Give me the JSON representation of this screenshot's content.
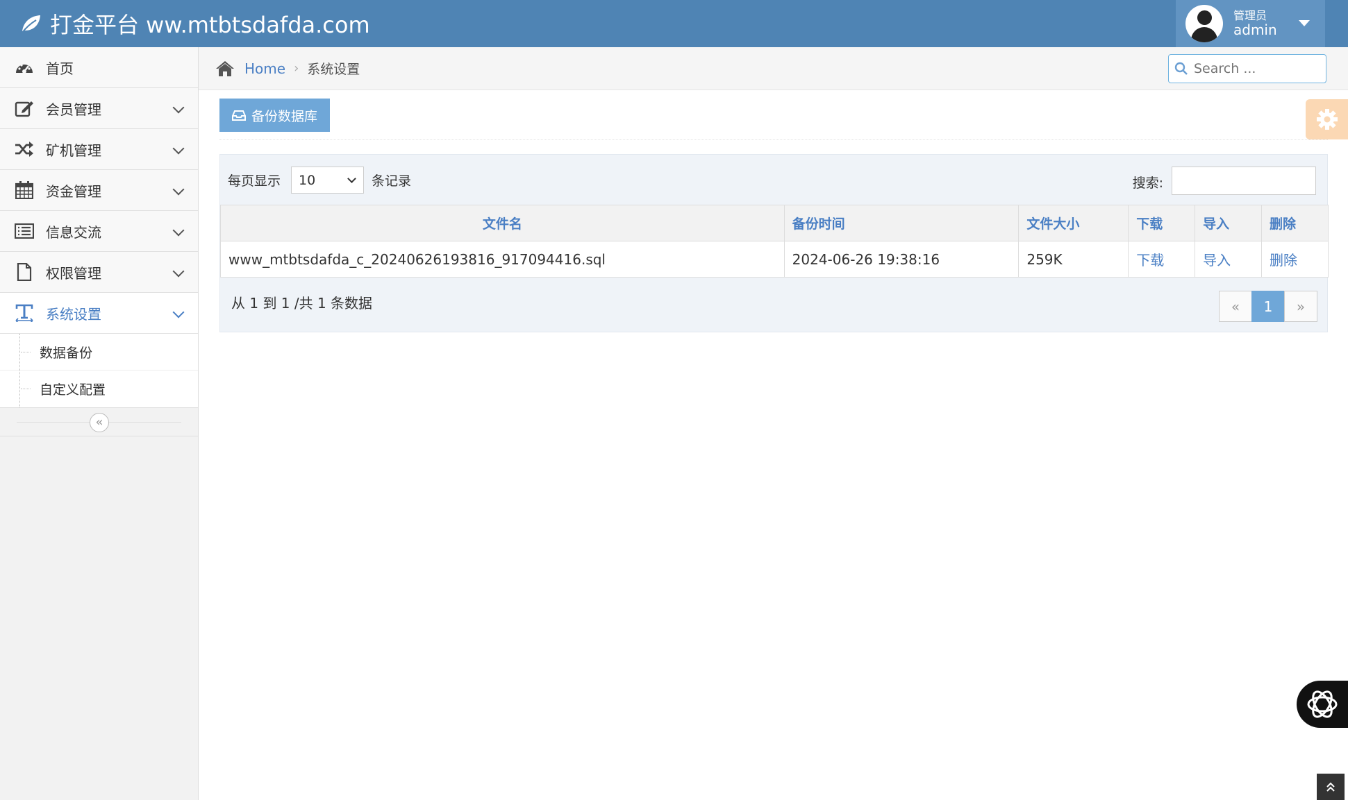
{
  "header": {
    "brand": "打金平台 ww.mtbtsdafda.com",
    "user_role": "管理员",
    "user_name": "admin"
  },
  "sidebar": {
    "items": [
      {
        "label": "首页",
        "icon": "dashboard-icon"
      },
      {
        "label": "会员管理",
        "icon": "edit-icon"
      },
      {
        "label": "矿机管理",
        "icon": "shuffle-icon"
      },
      {
        "label": "资金管理",
        "icon": "calendar-icon"
      },
      {
        "label": "信息交流",
        "icon": "list-icon"
      },
      {
        "label": "权限管理",
        "icon": "file-icon"
      },
      {
        "label": "系统设置",
        "icon": "text-icon",
        "active": true
      }
    ],
    "submenu": [
      {
        "label": "数据备份"
      },
      {
        "label": "自定义配置"
      }
    ],
    "collapse_glyph": "«"
  },
  "breadcrumb": {
    "home": "Home",
    "current": "系统设置"
  },
  "search": {
    "placeholder": "Search ..."
  },
  "toolbar": {
    "backup_label": "备份数据库"
  },
  "table_controls": {
    "length_prefix": "每页显示",
    "length_value": "10",
    "length_suffix": "条记录",
    "filter_label": "搜索:"
  },
  "table": {
    "columns": [
      "文件名",
      "备份时间",
      "文件大小",
      "下载",
      "导入",
      "删除"
    ],
    "rows": [
      {
        "filename": "www_mtbtsdafda_c_20240626193816_917094416.sql",
        "time": "2024-06-26 19:38:16",
        "size": "259K",
        "download": "下载",
        "import": "导入",
        "delete": "删除"
      }
    ]
  },
  "table_footer": {
    "info": "从 1 到 1 /共 1 条数据",
    "prev": "«",
    "current_page": "1",
    "next": "»"
  },
  "colors": {
    "navbar": "#4f84b4",
    "accent": "#4a7fc4",
    "button": "#6fa7d8",
    "settings_box": "#fbd8b4"
  }
}
